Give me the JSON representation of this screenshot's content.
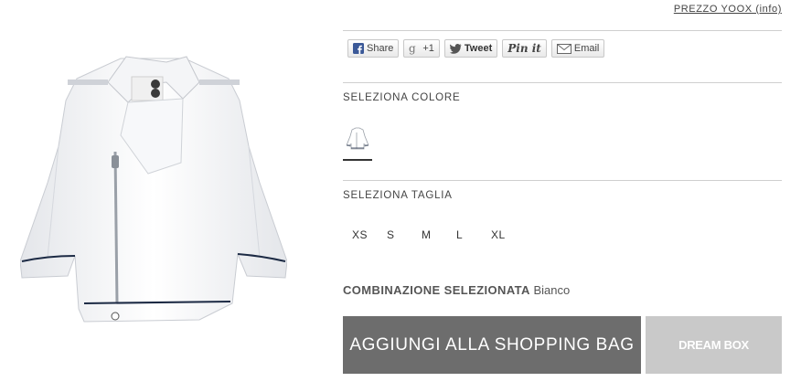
{
  "header": {
    "price_link": "PREZZO YOOX (info)"
  },
  "product": {
    "image_alt": "white cropped biker jacket"
  },
  "social": {
    "share": "Share",
    "gplus": "+1",
    "tweet": "Tweet",
    "pinit": "Pin it",
    "email": "Email"
  },
  "color_section": {
    "label": "SELEZIONA COLORE",
    "swatches": [
      {
        "name": "Bianco",
        "selected": true
      }
    ]
  },
  "size_section": {
    "label": "SELEZIONA TAGLIA",
    "sizes": [
      "XS",
      "S",
      "M",
      "L",
      "XL"
    ]
  },
  "selection": {
    "label": "COMBINAZIONE SELEZIONATA",
    "value": "Bianco"
  },
  "actions": {
    "add_to_bag": "AGGIUNGI ALLA SHOPPING BAG",
    "dream_box": "DREAM BOX"
  },
  "colors": {
    "primary_button": "#6d6d6d",
    "secondary_button": "#c9c9c9",
    "divider": "#cfcfcf"
  }
}
